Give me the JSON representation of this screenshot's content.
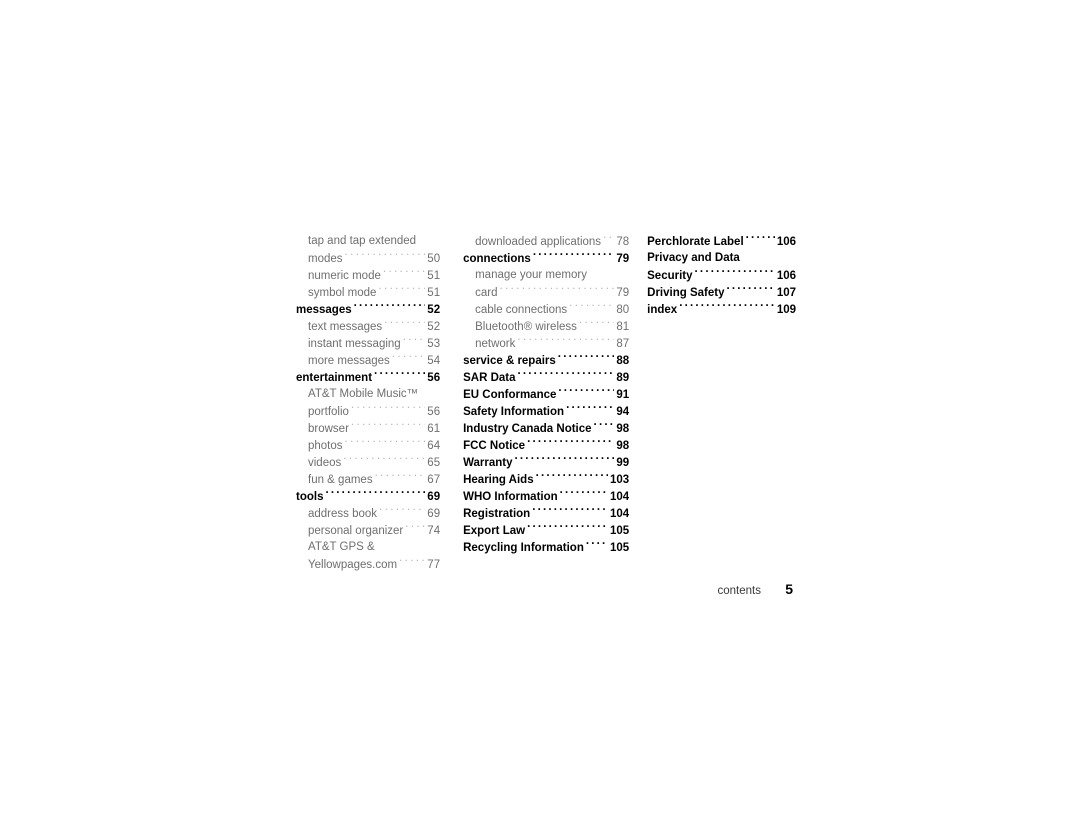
{
  "document": {
    "section_title": "contents",
    "page_number": "5"
  },
  "colors": {
    "heading_text": "#000000",
    "sub_text": "#6f6f6f",
    "leader_dots": "#b4b4b4",
    "page_background": "#ffffff"
  },
  "columns": [
    {
      "id": "column-1",
      "entries": [
        {
          "label": "tap and tap extended",
          "page": "",
          "style": "sub",
          "wrap": true
        },
        {
          "label": "modes",
          "page": "50",
          "style": "sub",
          "wrap": false
        },
        {
          "label": "numeric mode",
          "page": "51",
          "style": "sub",
          "wrap": false
        },
        {
          "label": "symbol mode",
          "page": "51",
          "style": "sub",
          "wrap": false
        },
        {
          "label": "messages",
          "page": "52",
          "style": "head",
          "wrap": false
        },
        {
          "label": "text messages",
          "page": "52",
          "style": "sub",
          "wrap": false
        },
        {
          "label": "instant messaging",
          "page": "53",
          "style": "sub",
          "wrap": false
        },
        {
          "label": "more messages",
          "page": "54",
          "style": "sub",
          "wrap": false
        },
        {
          "label": "entertainment",
          "page": "56",
          "style": "head",
          "wrap": false
        },
        {
          "label": "AT&T Mobile Music™",
          "page": "",
          "style": "sub",
          "wrap": true
        },
        {
          "label": "portfolio",
          "page": "56",
          "style": "sub",
          "wrap": false
        },
        {
          "label": "browser",
          "page": "61",
          "style": "sub",
          "wrap": false
        },
        {
          "label": "photos",
          "page": "64",
          "style": "sub",
          "wrap": false
        },
        {
          "label": "videos",
          "page": "65",
          "style": "sub",
          "wrap": false
        },
        {
          "label": "fun & games",
          "page": "67",
          "style": "sub",
          "wrap": false
        },
        {
          "label": "tools",
          "page": "69",
          "style": "head",
          "wrap": false
        },
        {
          "label": "address book",
          "page": "69",
          "style": "sub",
          "wrap": false
        },
        {
          "label": "personal organizer",
          "page": "74",
          "style": "sub",
          "wrap": false
        },
        {
          "label": "AT&T GPS &",
          "page": "",
          "style": "sub",
          "wrap": true
        },
        {
          "label": "Yellowpages.com",
          "page": "77",
          "style": "sub",
          "wrap": false
        }
      ]
    },
    {
      "id": "column-2",
      "entries": [
        {
          "label": "downloaded applications",
          "page": "78",
          "style": "sub",
          "wrap": false
        },
        {
          "label": "connections",
          "page": "79",
          "style": "head",
          "wrap": false
        },
        {
          "label": "manage your memory",
          "page": "",
          "style": "sub",
          "wrap": true
        },
        {
          "label": "card",
          "page": "79",
          "style": "sub",
          "wrap": false
        },
        {
          "label": "cable connections",
          "page": "80",
          "style": "sub",
          "wrap": false
        },
        {
          "label": "Bluetooth® wireless",
          "page": "81",
          "style": "sub",
          "wrap": false
        },
        {
          "label": "network",
          "page": "87",
          "style": "sub",
          "wrap": false
        },
        {
          "label": "service & repairs",
          "page": "88",
          "style": "head",
          "wrap": false
        },
        {
          "label": "SAR Data",
          "page": "89",
          "style": "head",
          "wrap": false
        },
        {
          "label": "EU Conformance",
          "page": "91",
          "style": "head",
          "wrap": false
        },
        {
          "label": "Safety Information",
          "page": "94",
          "style": "head",
          "wrap": false
        },
        {
          "label": "Industry Canada Notice",
          "page": "98",
          "style": "head",
          "wrap": false
        },
        {
          "label": "FCC Notice",
          "page": "98",
          "style": "head",
          "wrap": false
        },
        {
          "label": "Warranty",
          "page": "99",
          "style": "head",
          "wrap": false
        },
        {
          "label": "Hearing Aids",
          "page": "103",
          "style": "head",
          "wrap": false
        },
        {
          "label": "WHO Information",
          "page": "104",
          "style": "head",
          "wrap": false
        },
        {
          "label": "Registration",
          "page": "104",
          "style": "head",
          "wrap": false
        },
        {
          "label": "Export Law",
          "page": "105",
          "style": "head",
          "wrap": false
        },
        {
          "label": "Recycling Information",
          "page": "105",
          "style": "head",
          "wrap": false
        }
      ]
    },
    {
      "id": "column-3",
      "entries": [
        {
          "label": "Perchlorate Label",
          "page": "106",
          "style": "head",
          "wrap": false
        },
        {
          "label": "Privacy and Data",
          "page": "",
          "style": "head",
          "wrap": true
        },
        {
          "label": "Security",
          "page": "106",
          "style": "head",
          "wrap": false
        },
        {
          "label": "Driving Safety",
          "page": "107",
          "style": "head",
          "wrap": false
        },
        {
          "label": "index",
          "page": "109",
          "style": "head",
          "wrap": false
        }
      ]
    }
  ]
}
